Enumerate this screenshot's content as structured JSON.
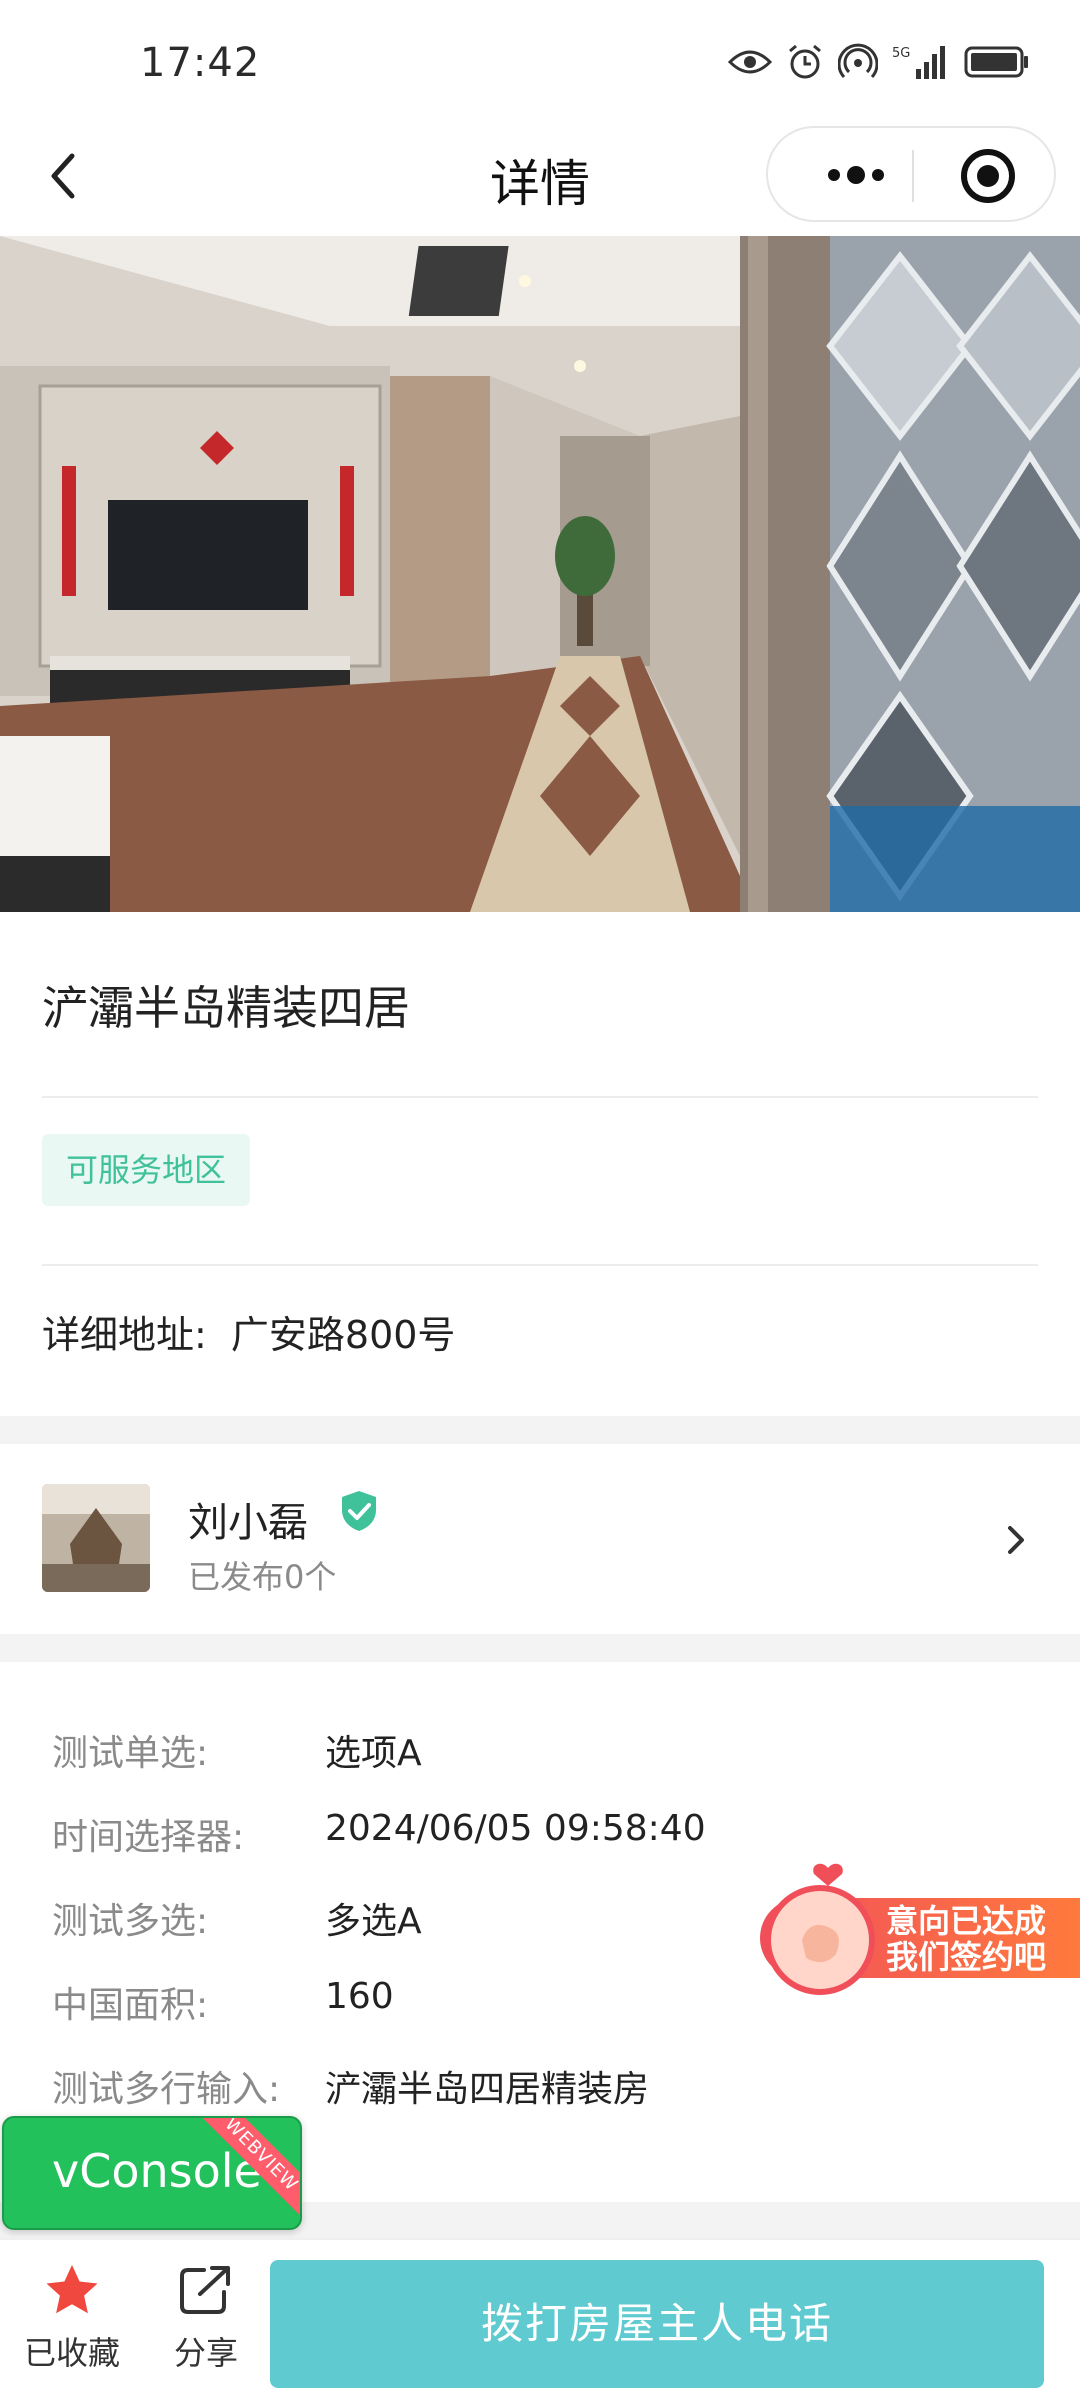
{
  "status_bar": {
    "time": "17:42",
    "network": "5G"
  },
  "nav": {
    "title": "详情"
  },
  "listing": {
    "title": "浐灞半岛精装四居",
    "service_tag": "可服务地区",
    "address_label": "详细地址:",
    "address_value": "广安路800号"
  },
  "publisher": {
    "name": "刘小磊",
    "published": "已发布0个"
  },
  "attributes": [
    {
      "label": "测试单选:",
      "value": "选项A"
    },
    {
      "label": "时间选择器:",
      "value": "2024/06/05 09:58:40"
    },
    {
      "label": "测试多选:",
      "value": "多选A"
    },
    {
      "label": "中国面积:",
      "value": "160"
    },
    {
      "label": "测试多行输入:",
      "value": "浐灞半岛四居精装房"
    }
  ],
  "promo": {
    "line1": "意向已达成",
    "line2": "我们签约吧"
  },
  "vconsole": {
    "label": "vConsole",
    "ribbon": "WEBVIEW"
  },
  "bottom_bar": {
    "favorite_label": "已收藏",
    "share_label": "分享",
    "call_button": "拨打房屋主人电话"
  },
  "colors": {
    "accent_green": "#3fc19a",
    "call_button": "#5fcbd0",
    "favorite_star": "#f0483e",
    "vconsole": "#23c15b"
  }
}
